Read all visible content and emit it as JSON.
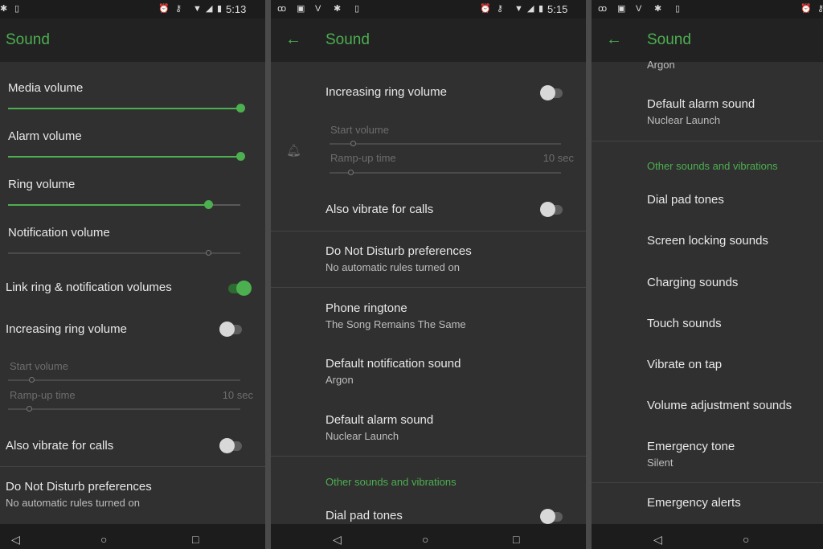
{
  "accent": "#4caf50",
  "icons": {
    "status_left": [
      "voicemail-icon",
      "image-icon",
      "vine-icon",
      "leaf-icon",
      "sim-icon"
    ],
    "status_right": [
      "alarm-icon",
      "vpn-key-icon",
      "wifi-icon",
      "signal-icon",
      "battery-icon"
    ],
    "nav": [
      "back-icon",
      "home-icon",
      "recents-icon"
    ]
  },
  "p1": {
    "time": "5:13",
    "title": "Sound",
    "media": "Media volume",
    "media_level": 1.0,
    "alarm": "Alarm volume",
    "alarm_level": 1.0,
    "ring": "Ring volume",
    "ring_level": 0.86,
    "notif": "Notification volume",
    "notif_level": 0.86,
    "link": "Link ring & notification volumes",
    "link_on": true,
    "inc": "Increasing ring volume",
    "inc_on": false,
    "start": "Start volume",
    "ramp": "Ramp-up time",
    "ramp_val": "10 sec",
    "vib": "Also vibrate for calls",
    "vib_on": false,
    "dnd": "Do Not Disturb preferences",
    "dnd_sub": "No automatic rules turned on"
  },
  "p2": {
    "time": "5:15",
    "title": "Sound",
    "inc": "Increasing ring volume",
    "start": "Start volume",
    "ramp": "Ramp-up time",
    "ramp_val": "10 sec",
    "vib": "Also vibrate for calls",
    "dnd": "Do Not Disturb preferences",
    "dnd_sub": "No automatic rules turned on",
    "ring": "Phone ringtone",
    "ring_sub": "The Song Remains The Same",
    "notif": "Default notification sound",
    "notif_sub": "Argon",
    "alarm": "Default alarm sound",
    "alarm_sub": "Nuclear Launch",
    "other": "Other sounds and vibrations",
    "dial": "Dial pad tones"
  },
  "p3": {
    "title": "Sound",
    "argon": "Argon",
    "alarm": "Default alarm sound",
    "alarm_sub": "Nuclear Launch",
    "other": "Other sounds and vibrations",
    "items": [
      "Dial pad tones",
      "Screen locking sounds",
      "Charging sounds",
      "Touch sounds",
      "Vibrate on tap",
      "Volume adjustment sounds"
    ],
    "etone": "Emergency tone",
    "etone_sub": "Silent",
    "alerts": "Emergency alerts"
  }
}
